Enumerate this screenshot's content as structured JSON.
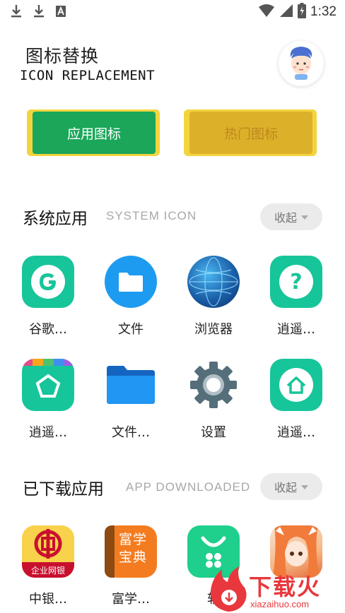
{
  "status_bar": {
    "time": "1:32",
    "icons": [
      "download-icon",
      "download-icon",
      "a-icon",
      "wifi-icon",
      "signal-icon",
      "battery-icon"
    ]
  },
  "header": {
    "title_cn": "图标替换",
    "title_en": "ICON REPLACEMENT",
    "avatar_icon": "cartoon-avatar-icon"
  },
  "tabs": {
    "app_icons": "应用图标",
    "hot_icons": "热门图标"
  },
  "system_section": {
    "title": "系统应用",
    "subtitle": "SYSTEM ICON",
    "collapse_label": "收起",
    "apps": [
      {
        "label": "谷歌…",
        "icon": "google-icon"
      },
      {
        "label": "文件",
        "icon": "folder-icon"
      },
      {
        "label": "浏览器",
        "icon": "globe-icon"
      },
      {
        "label": "逍遥…",
        "icon": "help-icon"
      },
      {
        "label": "逍遥…",
        "icon": "shopping-bag-icon"
      },
      {
        "label": "文件…",
        "icon": "file-folder-icon"
      },
      {
        "label": "设置",
        "icon": "gear-icon"
      },
      {
        "label": "逍遥…",
        "icon": "home-icon"
      }
    ]
  },
  "downloaded_section": {
    "title": "已下载应用",
    "subtitle": "APP DOWNLOADED",
    "collapse_label": "收起",
    "apps": [
      {
        "label": "中银…",
        "icon": "bank-of-china-icon",
        "icon_text": "企业网银"
      },
      {
        "label": "富学…",
        "icon": "dictionary-icon",
        "icon_text": "富学宝典"
      },
      {
        "label": "软",
        "icon": "app-store-icon"
      },
      {
        "label": "",
        "icon": "anime-character-icon"
      }
    ]
  },
  "watermark": {
    "brand": "下载火",
    "domain": "xiazaihuo.com"
  },
  "colors": {
    "accent_green": "#1ba65a",
    "button_yellow": "#f3d43e",
    "teal_icon": "#17c59a"
  }
}
